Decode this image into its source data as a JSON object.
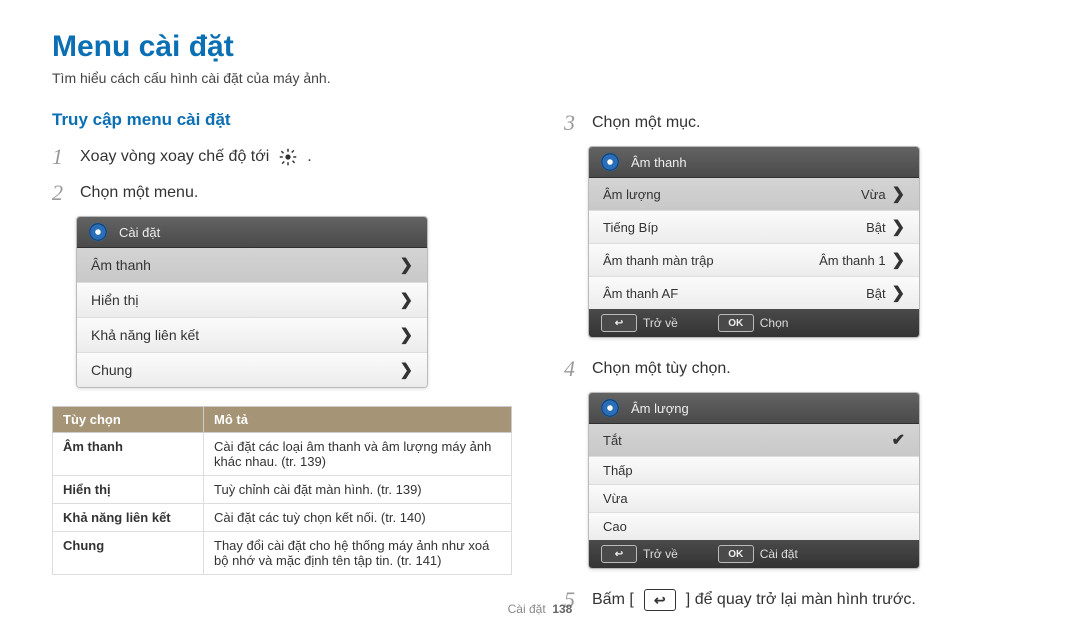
{
  "title": "Menu cài đặt",
  "subtitle": "Tìm hiểu cách cấu hình cài đặt của máy ảnh.",
  "section_title": "Truy cập menu cài đặt",
  "left": {
    "step1": {
      "num": "1",
      "text_before": "Xoay vòng xoay chế độ tới",
      "text_after": "."
    },
    "step2": {
      "num": "2",
      "text": "Chọn một menu."
    },
    "panel": {
      "header": "Cài đặt",
      "rows": [
        {
          "label": "Âm thanh",
          "selected": true
        },
        {
          "label": "Hiển thị"
        },
        {
          "label": "Khả năng liên kết"
        },
        {
          "label": "Chung"
        }
      ]
    },
    "table": {
      "h1": "Tùy chọn",
      "h2": "Mô tả",
      "rows": [
        {
          "opt": "Âm thanh",
          "desc": "Cài đặt các loại âm thanh và âm lượng máy ảnh khác nhau. (tr. 139)"
        },
        {
          "opt": "Hiển thị",
          "desc": "Tuỳ chỉnh cài đặt màn hình. (tr. 139)"
        },
        {
          "opt": "Khả năng liên kết",
          "desc": "Cài đặt các tuỳ chọn kết nối. (tr. 140)"
        },
        {
          "opt": "Chung",
          "desc": "Thay đổi cài đặt cho hệ thống máy ảnh như xoá bộ nhớ và mặc định tên tập tin. (tr. 141)"
        }
      ]
    }
  },
  "right": {
    "step3": {
      "num": "3",
      "text": "Chọn một mục."
    },
    "panel3": {
      "header": "Âm thanh",
      "rows": [
        {
          "label": "Âm lượng",
          "value": "Vừa",
          "selected": true
        },
        {
          "label": "Tiếng Bíp",
          "value": "Bật"
        },
        {
          "label": "Âm thanh màn trập",
          "value": "Âm thanh 1"
        },
        {
          "label": "Âm thanh AF",
          "value": "Bật"
        }
      ],
      "foot_back": "Trở về",
      "foot_ok": "Chọn",
      "back_key": "↩",
      "ok_key": "OK"
    },
    "step4": {
      "num": "4",
      "text": "Chọn một tùy chọn."
    },
    "panel4": {
      "header": "Âm lượng",
      "rows": [
        {
          "label": "Tắt",
          "selected": true,
          "check": true
        },
        {
          "label": "Thấp"
        },
        {
          "label": "Vừa"
        },
        {
          "label": "Cao"
        }
      ],
      "foot_back": "Trở về",
      "foot_ok": "Cài đặt",
      "back_key": "↩",
      "ok_key": "OK"
    },
    "step5": {
      "num": "5",
      "text_before": "Bấm [",
      "key": "↩",
      "text_after": "] để quay trở lại màn hình trước."
    }
  },
  "footer": {
    "section": "Cài đặt",
    "page": "138"
  }
}
